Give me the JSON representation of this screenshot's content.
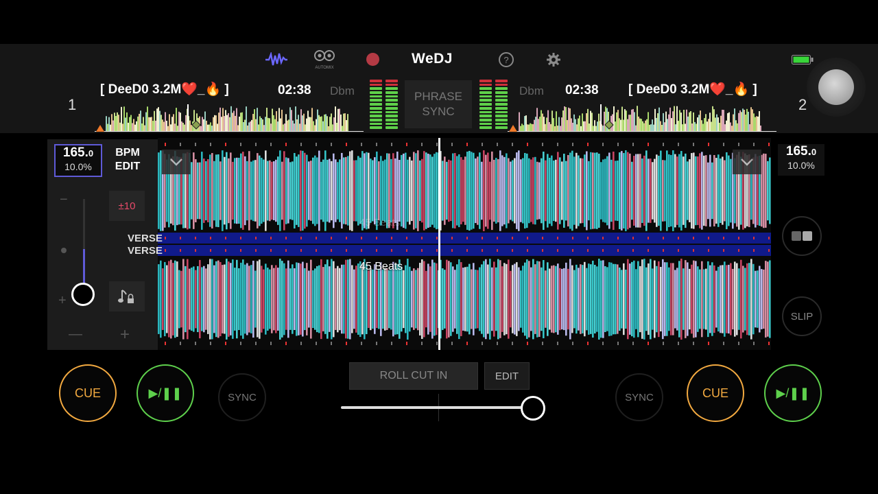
{
  "app": {
    "brand": "WeDJ",
    "automix_label": "AUTOMIX"
  },
  "icons": {
    "waveform": "waveform-icon",
    "automix": "automix-icon",
    "record": "record-icon",
    "help": "help-icon",
    "settings": "gear-icon",
    "battery": "battery-icon",
    "jog": "jog-icon"
  },
  "colors": {
    "accent_purple": "#5f5ad8",
    "cue": "#f2a940",
    "play": "#5ed04c",
    "record": "#b43a44",
    "phrase_band": "#101a8a"
  },
  "deck1": {
    "number": "1",
    "title": "[ DeeD0 3.2M❤️_🔥 ]",
    "time": "02:38",
    "key": "Dbm",
    "bpm": "165.",
    "bpm_decimal": "0",
    "pitch": "10.0%"
  },
  "deck2": {
    "number": "2",
    "title": "[ DeeD0 3.2M❤️_🔥 ]",
    "time": "02:38",
    "key": "Dbm",
    "bpm": "165.",
    "bpm_decimal": "0",
    "pitch": "10.0%"
  },
  "center": {
    "phrase_sync_label": "PHRASE SYNC"
  },
  "waveform": {
    "phrase_upper": "VERSE",
    "phrase_lower": "VERSE",
    "beats_label": "45 Beats",
    "beats_label_ghost": "45 Beats"
  },
  "tempo_panel": {
    "bpm_edit_label": "BPM EDIT",
    "range_label": "±10",
    "minus_label": "−",
    "plus_label": "+",
    "bottom_minus": "—",
    "bottom_plus": "+"
  },
  "transport": {
    "cue_label": "CUE",
    "play_label": "▶/❚❚",
    "sync_label": "SYNC",
    "slip_label": "SLIP"
  },
  "fx": {
    "roll_label": "ROLL CUT IN",
    "edit_label": "EDIT",
    "crossfader_position": 1.0
  }
}
